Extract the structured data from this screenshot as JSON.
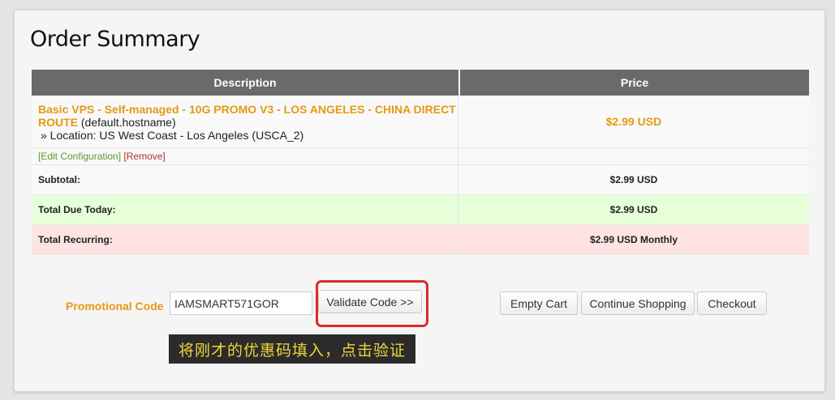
{
  "page": {
    "title": "Order Summary"
  },
  "table": {
    "headers": {
      "description": "Description",
      "price": "Price"
    },
    "item": {
      "product_name": "Basic VPS - Self-managed",
      "product_suffix": " - 10G PROMO V3 - LOS ANGELES - CHINA DIRECT ROUTE",
      "hostname": " (default.hostname)",
      "location": "» Location: US West Coast - Los Angeles (USCA_2)",
      "price": "$2.99 USD",
      "edit_label": "[Edit Configuration]",
      "remove_label": "[Remove]"
    },
    "subtotal": {
      "label": "Subtotal:",
      "value": "$2.99 USD"
    },
    "total_due": {
      "label": "Total Due Today:",
      "value": "$2.99 USD"
    },
    "total_recurring": {
      "label": "Total Recurring:",
      "value": "$2.99 USD Monthly"
    }
  },
  "promo": {
    "label": "Promotional Code",
    "value": "IAMSMART571GOR",
    "validate_label": "Validate Code >>"
  },
  "actions": {
    "empty_cart": "Empty Cart",
    "continue_shopping": "Continue Shopping",
    "checkout": "Checkout"
  },
  "annotation": {
    "text": "将刚才的优惠码填入，点击验证"
  },
  "colors": {
    "accent": "#e59a14",
    "header_bg": "#6a6a6a",
    "due_bg": "#e6ffd9",
    "recurring_bg": "#ffe3e3",
    "highlight": "#e0282c"
  }
}
